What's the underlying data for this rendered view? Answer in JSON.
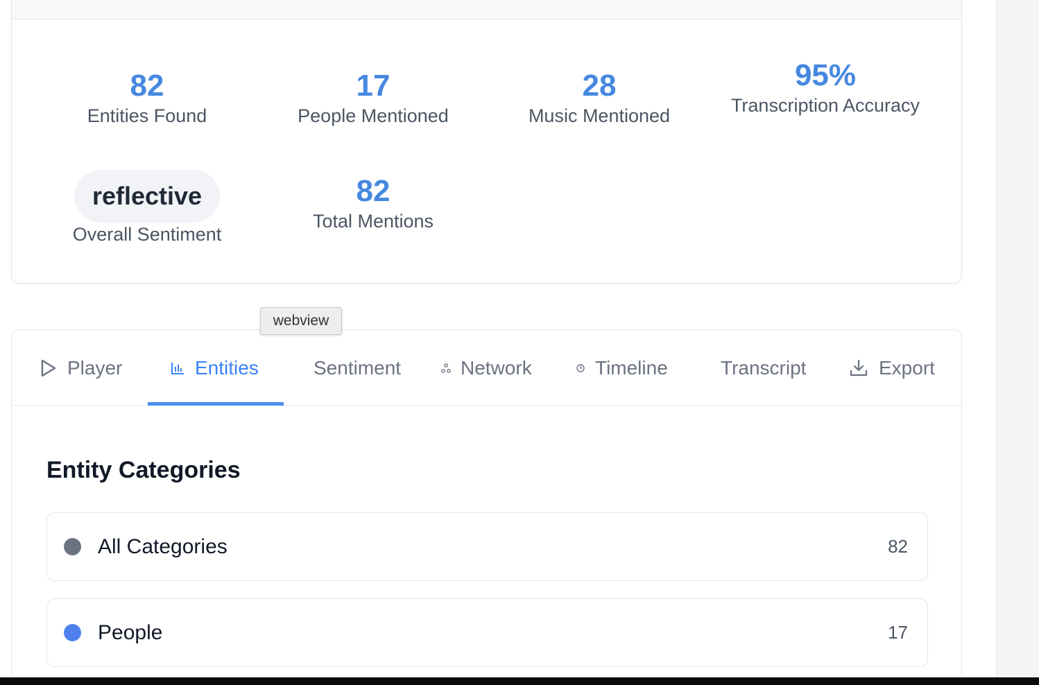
{
  "stats": {
    "entities_found": {
      "value": "82",
      "label": "Entities Found"
    },
    "people_mentioned": {
      "value": "17",
      "label": "People Mentioned"
    },
    "music_mentioned": {
      "value": "28",
      "label": "Music Mentioned"
    },
    "transcription_accuracy": {
      "value": "95%",
      "label": "Transcription Accuracy"
    },
    "overall_sentiment": {
      "value": "reflective",
      "label": "Overall Sentiment"
    },
    "total_mentions": {
      "value": "82",
      "label": "Total Mentions"
    }
  },
  "tooltip": {
    "text": "webview"
  },
  "tabs": [
    {
      "label": "Player",
      "icon": "play-icon",
      "active": false
    },
    {
      "label": "Entities",
      "icon": "bar-chart-icon",
      "active": true
    },
    {
      "label": "Sentiment",
      "icon": "",
      "active": false
    },
    {
      "label": "Network",
      "icon": "network-icon",
      "active": false
    },
    {
      "label": "Timeline",
      "icon": "clock-icon",
      "active": false
    },
    {
      "label": "Transcript",
      "icon": "",
      "active": false
    },
    {
      "label": "Export",
      "icon": "download-icon",
      "active": false
    }
  ],
  "entities": {
    "title": "Entity Categories",
    "categories": [
      {
        "label": "All Categories",
        "count": "82",
        "color": "#6b7280"
      },
      {
        "label": "People",
        "count": "17",
        "color": "#4f80ee"
      }
    ]
  },
  "colors": {
    "accent": "#4688e0",
    "active_tab": "#3b82f6",
    "muted_text": "#6b7280"
  }
}
